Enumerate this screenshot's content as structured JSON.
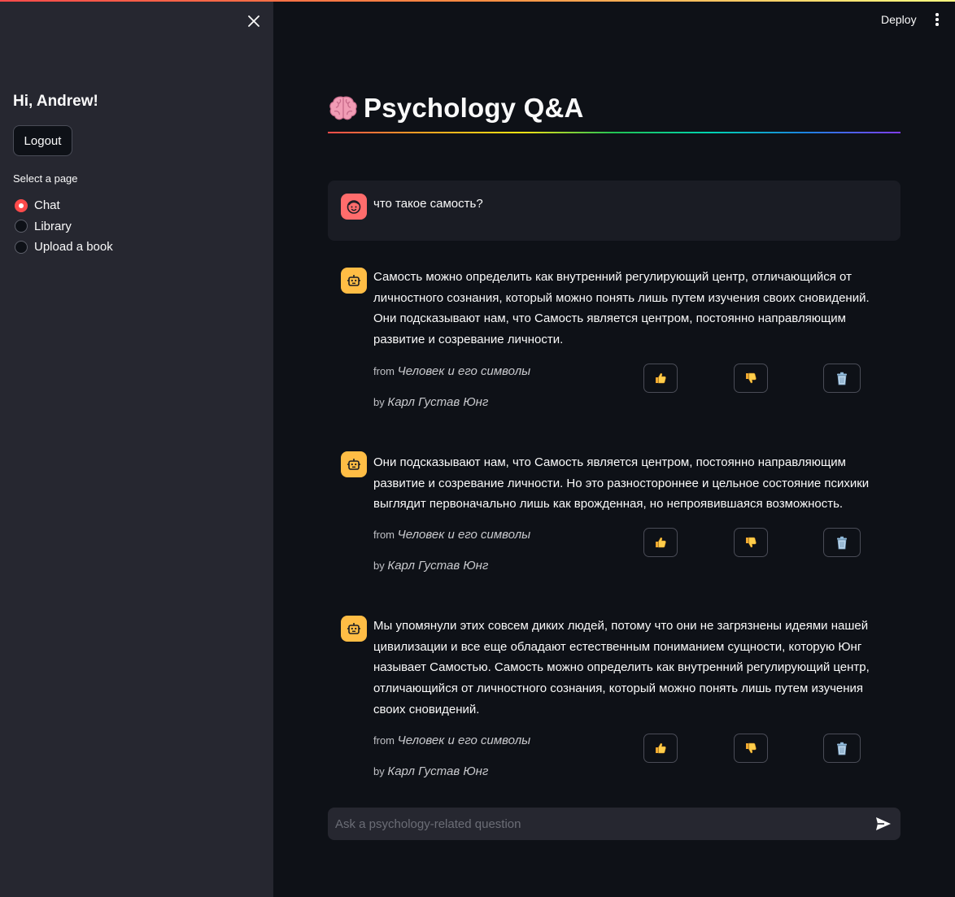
{
  "sidebar": {
    "greeting": "Hi, Andrew!",
    "logout_label": "Logout",
    "select_label": "Select a page",
    "pages": [
      {
        "label": "Chat",
        "selected": true
      },
      {
        "label": "Library",
        "selected": false
      },
      {
        "label": "Upload a book",
        "selected": false
      }
    ]
  },
  "header": {
    "deploy_label": "Deploy"
  },
  "main": {
    "title": "Psychology Q&A",
    "user_message": "что такое самость?",
    "responses": [
      {
        "text": "Самость можно определить как внутренний регулирующий центр, отличающийся от личностного сознания, который можно понять лишь путем изучения своих сновидений. Они подсказывают нам, что Самость является центром, постоянно направляющим развитие и созревание личности.",
        "from_label": "from",
        "book": "Человек и его символы",
        "by_label": "by",
        "author": "Карл Густав Юнг"
      },
      {
        "text": "Они подсказывают нам, что Самость является центром, постоянно направляющим развитие и созревание личности. Но это разностороннее и цельное состояние психики выглядит первоначально лишь как врожденная, но непроявившаяся возможность.",
        "from_label": "from",
        "book": "Человек и его символы",
        "by_label": "by",
        "author": "Карл Густав Юнг"
      },
      {
        "text": "Мы упомянули этих совсем диких людей, потому что они не загрязнены идеями нашей цивилизации и все еще обладают естественным пониманием сущности, которую Юнг называет Самостью. Самость можно определить как внутренний регулирующий центр, отличающийся от личностного сознания, который можно понять лишь путем изучения своих сновидений.",
        "from_label": "from",
        "book": "Человек и его символы",
        "by_label": "by",
        "author": "Карл Густав Юнг"
      }
    ],
    "chat_input_placeholder": "Ask a psychology-related question"
  },
  "icons": {
    "title": "brain-icon",
    "user_avatar": "face-icon",
    "bot_avatar": "robot-icon",
    "like": "thumbs-up-icon",
    "dislike": "thumbs-down-icon",
    "delete": "trash-icon",
    "send": "send-icon",
    "close": "close-icon",
    "menu": "kebab-menu-icon"
  },
  "colors": {
    "accent": "#ff4b4b",
    "bot_avatar": "#ffbd45",
    "user_avatar": "#ff6c6c",
    "sidebar_bg": "#262730",
    "main_bg": "#0e1117"
  }
}
